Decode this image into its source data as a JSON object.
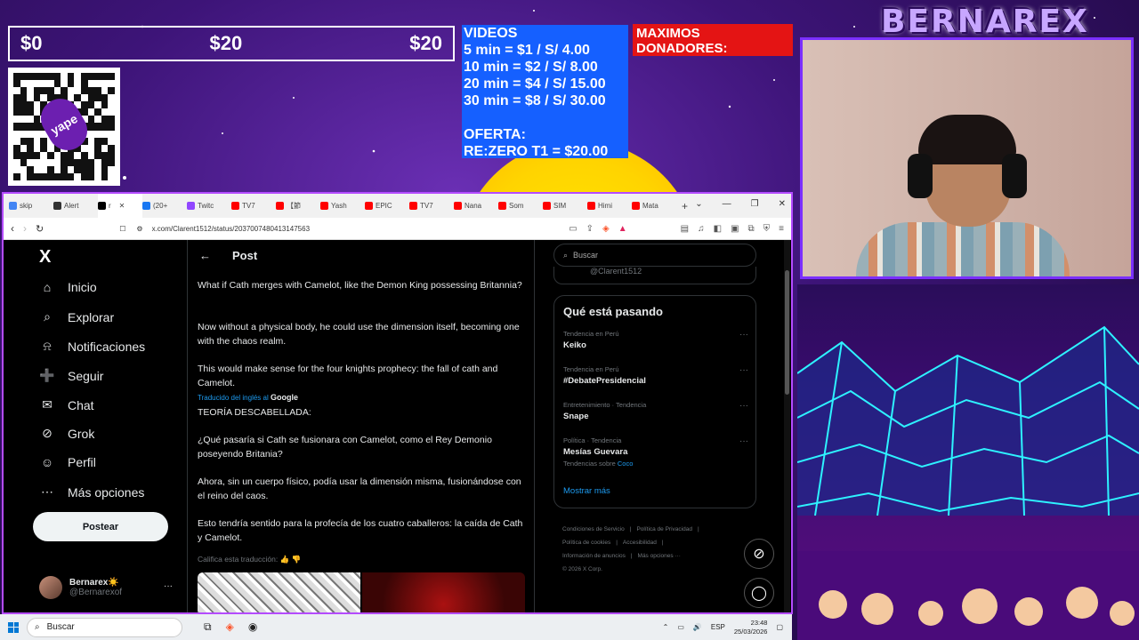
{
  "stream": {
    "brand": "BERNAREX",
    "donation_goal": {
      "start": "$0",
      "current": "$20",
      "goal": "$20"
    },
    "videos": {
      "lines": [
        "VIDEOS",
        "5 min = $1 / S/ 4.00",
        "10 min = $2 / S/ 8.00",
        "20 min = $4 / S/ 15.00",
        "30 min = $8 / S/ 30.00",
        "",
        "OFERTA:",
        "RE:ZERO T1 = $20.00"
      ]
    },
    "donors_title": "MAXIMOS DONADORES:",
    "qr_logo": "yape"
  },
  "browser": {
    "tabs": [
      {
        "label": "skip",
        "color": "#4285f4"
      },
      {
        "label": "Alert",
        "color": "#333333"
      },
      {
        "label": "r",
        "color": "#000000",
        "active": true
      },
      {
        "label": "(20+",
        "color": "#1877f2"
      },
      {
        "label": "Twitc",
        "color": "#9146ff"
      },
      {
        "label": "TV7",
        "color": "#ff0000"
      },
      {
        "label": "【節",
        "color": "#ff0000"
      },
      {
        "label": "Yash",
        "color": "#ff0000"
      },
      {
        "label": "EPIC",
        "color": "#ff0000"
      },
      {
        "label": "TV7",
        "color": "#ff0000"
      },
      {
        "label": "Nana",
        "color": "#ff0000"
      },
      {
        "label": "Som",
        "color": "#ff0000"
      },
      {
        "label": "SIM",
        "color": "#ff0000"
      },
      {
        "label": "Himi",
        "color": "#ff0000"
      },
      {
        "label": "Mata",
        "color": "#ff0000"
      }
    ],
    "new_tab": "+",
    "url": "x.com/Clarent1512/status/2037007480413147563"
  },
  "nav": {
    "logo": "X",
    "items": [
      {
        "label": "Inicio",
        "icon": "⌂"
      },
      {
        "label": "Explorar",
        "icon": "⌕"
      },
      {
        "label": "Notificaciones",
        "icon": "⍾"
      },
      {
        "label": "Seguir",
        "icon": "➕"
      },
      {
        "label": "Chat",
        "icon": "✉"
      },
      {
        "label": "Grok",
        "icon": "⊘"
      },
      {
        "label": "Perfil",
        "icon": "☺"
      },
      {
        "label": "Más opciones",
        "icon": "⋯"
      }
    ],
    "post_button": "Postear",
    "account": {
      "name": "Bernarex☀️",
      "handle": "@Bernarexof",
      "more": "···"
    }
  },
  "post": {
    "back": "←",
    "title": "Post",
    "original": [
      "What if Cath merges with Camelot, like the Demon King possessing Britannia?",
      "Now without a physical body, he could use the dimension itself, becoming  one with the chaos realm.",
      "This would make sense for the four knights prophecy: the fall of cath and Camelot."
    ],
    "translated_label": "Traducido del inglés al",
    "translated_by": "Google",
    "translation": [
      "TEORÍA DESCABELLADA:",
      "¿Qué pasaría si Cath se fusionara con Camelot, como el Rey Demonio poseyendo Britania?",
      "Ahora, sin un cuerpo físico, podía usar la dimensión misma, fusionándose con el reino del caos.",
      "Esto tendría sentido para la profecía de los cuatro caballeros: la caída de Cath y Camelot."
    ],
    "rate_translation": "Califica esta traducción:"
  },
  "sidebar": {
    "search_placeholder": "Buscar",
    "profile_handle": "@Clarent1512",
    "trends_title": "Qué está pasando",
    "trends": [
      {
        "meta": "Tendencia en Perú",
        "name": "Keiko",
        "sub": ""
      },
      {
        "meta": "Tendencia en Perú",
        "name": "#DebatePresidencial",
        "sub": ""
      },
      {
        "meta": "Entretenimiento · Tendencia",
        "name": "Snape",
        "sub": ""
      },
      {
        "meta": "Política · Tendencia",
        "name": "Mesías Guevara",
        "sub_prefix": "Tendencias sobre",
        "sub_link": "Coco"
      }
    ],
    "show_more": "Mostrar más",
    "footer": [
      "Condiciones de Servicio",
      "|",
      "Política de Privacidad",
      "|",
      "Política de cookies",
      "|",
      "Accesibilidad",
      "|",
      "Información de anuncios",
      "|",
      "Más opciones ···",
      "© 2026 X Corp."
    ]
  },
  "taskbar": {
    "search_label": "Buscar",
    "language": "ESP",
    "time": "23:48",
    "date": "25/03/2026"
  }
}
